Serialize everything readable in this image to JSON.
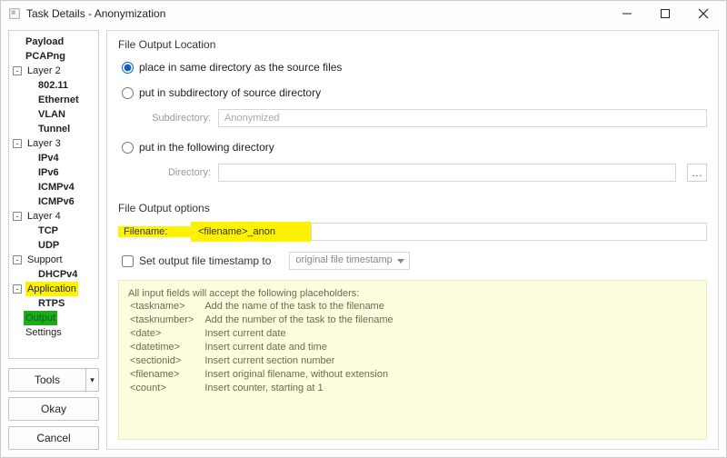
{
  "window": {
    "title": "Task Details - Anonymization"
  },
  "tree": {
    "items": [
      {
        "label": "Payload",
        "depth": 1,
        "bold": true
      },
      {
        "label": "PCAPng",
        "depth": 1,
        "bold": true
      },
      {
        "label": "Layer 2",
        "depth": 0,
        "expander": "-"
      },
      {
        "label": "802.11",
        "depth": 2,
        "bold": true
      },
      {
        "label": "Ethernet",
        "depth": 2,
        "bold": true
      },
      {
        "label": "VLAN",
        "depth": 2,
        "bold": true
      },
      {
        "label": "Tunnel",
        "depth": 2,
        "bold": true
      },
      {
        "label": "Layer 3",
        "depth": 0,
        "expander": "-"
      },
      {
        "label": "IPv4",
        "depth": 2,
        "bold": true
      },
      {
        "label": "IPv6",
        "depth": 2,
        "bold": true
      },
      {
        "label": "ICMPv4",
        "depth": 2,
        "bold": true
      },
      {
        "label": "ICMPv6",
        "depth": 2,
        "bold": true
      },
      {
        "label": "Layer 4",
        "depth": 0,
        "expander": "-"
      },
      {
        "label": "TCP",
        "depth": 2,
        "bold": true
      },
      {
        "label": "UDP",
        "depth": 2,
        "bold": true
      },
      {
        "label": "Support",
        "depth": 0,
        "expander": "-"
      },
      {
        "label": "DHCPv4",
        "depth": 2,
        "bold": true
      },
      {
        "label": "Application",
        "depth": 0,
        "expander": "-",
        "highlight": "yellow"
      },
      {
        "label": "RTPS",
        "depth": 2,
        "bold": true
      },
      {
        "label": "Output",
        "depth": 1,
        "highlight": "green"
      },
      {
        "label": "Settings",
        "depth": 1
      }
    ]
  },
  "sidebarButtons": {
    "tools": "Tools",
    "okay": "Okay",
    "cancel": "Cancel"
  },
  "output": {
    "locationTitle": "File Output Location",
    "radio_same": "place in same directory as the source files",
    "radio_sub": "put in subdirectory of source directory",
    "sub_label": "Subdirectory:",
    "sub_value": "Anonymized",
    "radio_dir": "put in the following directory",
    "dir_label": "Directory:",
    "dir_value": "",
    "optionsTitle": "File Output options",
    "filename_label": "Filename:",
    "filename_value": "<filename>_anon",
    "timestamp_check": "Set output file timestamp to",
    "timestamp_select": "original file timestamp"
  },
  "help": {
    "intro": "All input fields will accept the following placeholders:",
    "rows": [
      {
        "k": "<taskname>",
        "v": "Add the name of the task to the filename"
      },
      {
        "k": "<tasknumber>",
        "v": "Add the number of the task to the filename"
      },
      {
        "k": "<date>",
        "v": "Insert current date"
      },
      {
        "k": "<datetime>",
        "v": "Insert current date and time"
      },
      {
        "k": "<sectionid>",
        "v": "Insert current section number"
      },
      {
        "k": "<filename>",
        "v": "Insert original filename, without extension"
      },
      {
        "k": "<count>",
        "v": "Insert counter, starting at 1"
      }
    ]
  }
}
